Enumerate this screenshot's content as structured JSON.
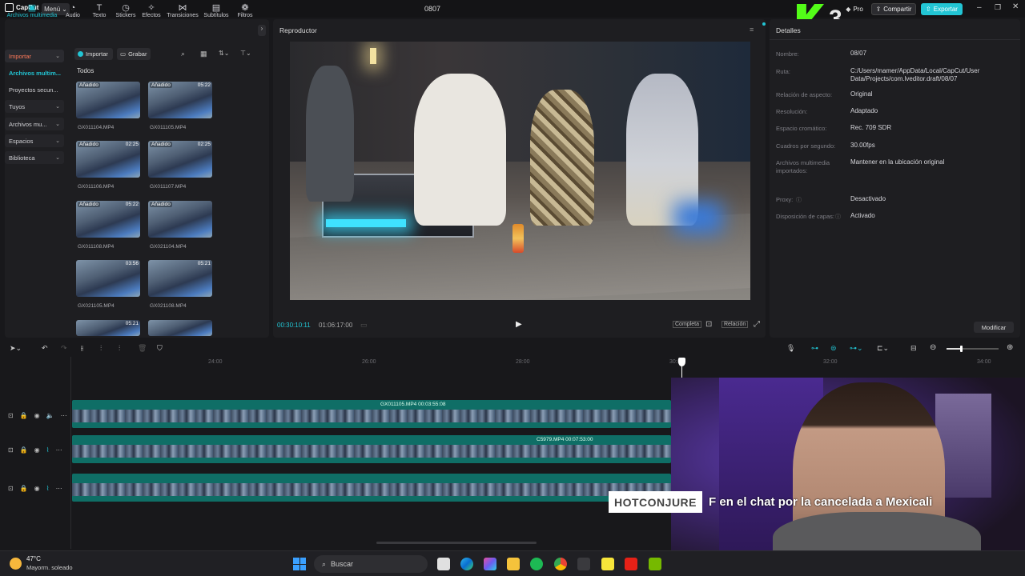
{
  "app": {
    "name": "CapCut",
    "menu_label": "Menú",
    "window_title": "0807",
    "pro_label": "Pro",
    "share_label": "Compartir",
    "export_label": "Exportar",
    "accent_color": "#22c5d4"
  },
  "overlay": {
    "kick_number": "3"
  },
  "toolbar": {
    "tools": [
      {
        "label": "Archivos multimedia",
        "icon": "media-icon",
        "active": true
      },
      {
        "label": "Audio",
        "icon": "audio-icon"
      },
      {
        "label": "Texto",
        "icon": "text-icon"
      },
      {
        "label": "Stickers",
        "icon": "sticker-icon"
      },
      {
        "label": "Efectos",
        "icon": "effects-icon"
      },
      {
        "label": "Transiciones",
        "icon": "transitions-icon"
      },
      {
        "label": "Subtítulos",
        "icon": "subtitles-icon"
      },
      {
        "label": "Filtros",
        "icon": "filters-icon"
      }
    ]
  },
  "media": {
    "sidebar": [
      {
        "label": "Importar",
        "chevron": true
      },
      {
        "label": "Archivos multim..."
      },
      {
        "label": "Proyectos secun..."
      },
      {
        "label": "Tuyos",
        "chevron": true
      },
      {
        "label": "Archivos mu...",
        "chevron": true
      },
      {
        "label": "Espacios",
        "chevron": true
      },
      {
        "label": "Biblioteca",
        "chevron": true
      }
    ],
    "import_label": "Importar",
    "record_label": "Grabar",
    "all_label": "Todos",
    "clips": [
      {
        "name": "GX011104.MP4",
        "badge": "Añadido",
        "duration": ""
      },
      {
        "name": "GX011105.MP4",
        "badge": "Añadido",
        "duration": "05:22"
      },
      {
        "name": "GX011106.MP4",
        "badge": "Añadido",
        "duration": "02:25"
      },
      {
        "name": "GX011107.MP4",
        "badge": "Añadido",
        "duration": "02:25"
      },
      {
        "name": "GX011108.MP4",
        "badge": "Añadido",
        "duration": "05:22"
      },
      {
        "name": "GX021104.MP4",
        "badge": "Añadido",
        "duration": ""
      },
      {
        "name": "GX021105.MP4",
        "badge": "",
        "duration": "03:56"
      },
      {
        "name": "GX021108.MP4",
        "badge": "",
        "duration": "05:21"
      },
      {
        "name": "",
        "badge": "",
        "duration": "05:21"
      },
      {
        "name": "",
        "badge": "",
        "duration": ""
      }
    ]
  },
  "player": {
    "title": "Reproductor",
    "current_time": "00:30:10:11",
    "total_time": "01:06:17:00",
    "full_label": "Completa",
    "ratio_label": "Relación"
  },
  "details": {
    "title": "Detalles",
    "rows": [
      {
        "label": "Nombre:",
        "value": "08/07"
      },
      {
        "label": "Ruta:",
        "value": "C:/Users/mamer/AppData/Local/CapCut/User Data/Projects/com.lveditor.draft/08/07"
      },
      {
        "label": "Relación de aspecto:",
        "value": "Original"
      },
      {
        "label": "Resolución:",
        "value": "Adaptado"
      },
      {
        "label": "Espacio cromático:",
        "value": "Rec. 709 SDR"
      },
      {
        "label": "Cuadros por segundo:",
        "value": "30.00fps"
      },
      {
        "label": "Archivos multimedia importados:",
        "value": "Mantener en la ubicación original"
      },
      {
        "label": "Proxy:",
        "value": "Desactivado"
      },
      {
        "label": "Disposición de capas:",
        "value": "Activado"
      }
    ],
    "modify_label": "Modificar"
  },
  "timeline": {
    "ticks": [
      "24:00",
      "26:00",
      "28:00",
      "30:00",
      "32:00",
      "34:00"
    ],
    "tracks": [
      {
        "clip_label": "GX011105.MP4  00:03:55:08"
      },
      {
        "clip_label": "C5979.MP4  00:07:53:00"
      },
      {
        "clip_label": ""
      }
    ]
  },
  "webcam": {
    "chat_user": "HOTCONJURE",
    "chat_message": "F en el chat por la cancelada a Mexicali"
  },
  "taskbar": {
    "weather_temp": "47°C",
    "weather_desc": "Mayorm. soleado",
    "search_placeholder": "Buscar"
  }
}
